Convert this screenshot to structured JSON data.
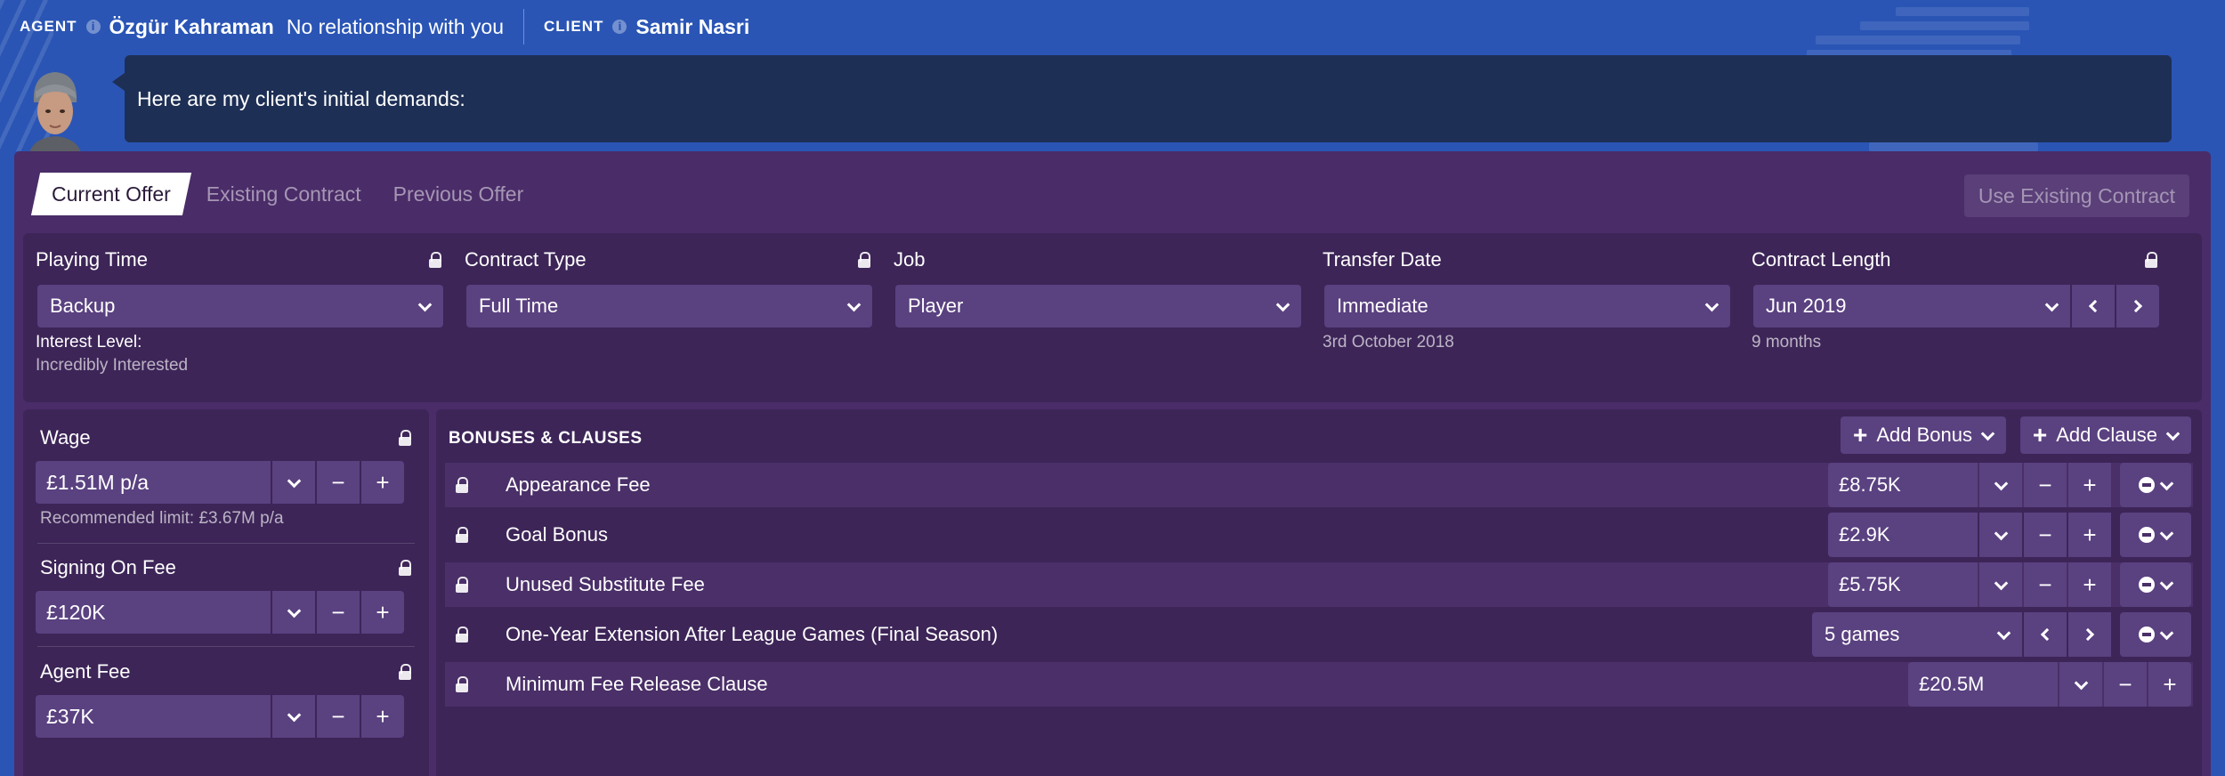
{
  "topbar": {
    "agent_label": "AGENT",
    "agent_name": "Özgür Kahraman",
    "agent_relationship": "No relationship with you",
    "client_label": "CLIENT",
    "client_name": "Samir Nasri"
  },
  "speech": {
    "text": "Here are my client's initial demands:"
  },
  "tabs": [
    {
      "label": "Current Offer",
      "active": true
    },
    {
      "label": "Existing Contract",
      "active": false
    },
    {
      "label": "Previous Offer",
      "active": false
    }
  ],
  "use_existing_button": "Use Existing Contract",
  "fields": {
    "playing_time": {
      "label": "Playing Time",
      "value": "Backup",
      "interest_label": "Interest Level:",
      "interest_value": "Incredibly Interested"
    },
    "contract_type": {
      "label": "Contract Type",
      "value": "Full Time"
    },
    "job": {
      "label": "Job",
      "value": "Player"
    },
    "transfer_date": {
      "label": "Transfer Date",
      "value": "Immediate",
      "sub": "3rd October 2018"
    },
    "contract_length": {
      "label": "Contract Length",
      "value": "Jun 2019",
      "sub": "9 months"
    }
  },
  "left": {
    "wage": {
      "label": "Wage",
      "value": "£1.51M p/a",
      "note": "Recommended limit: £3.67M p/a"
    },
    "signing_fee": {
      "label": "Signing On Fee",
      "value": "£120K"
    },
    "agent_fee": {
      "label": "Agent Fee",
      "value": "£37K"
    }
  },
  "bonuses": {
    "title": "BONUSES & CLAUSES",
    "add_bonus": "Add Bonus",
    "add_clause": "Add Clause",
    "rows": [
      {
        "name": "Appearance Fee",
        "value": "£8.75K"
      },
      {
        "name": "Goal Bonus",
        "value": "£2.9K"
      },
      {
        "name": "Unused Substitute Fee",
        "value": "£5.75K"
      },
      {
        "name": "One-Year Extension After League Games (Final Season)",
        "value": "5 games"
      },
      {
        "name": "Minimum Fee Release Clause",
        "value": "£20.5M"
      }
    ]
  },
  "symbols": {
    "minus": "−",
    "plus": "+"
  },
  "colors": {
    "background": "#2a55b5",
    "panel": "#4a2c68",
    "control": "#5a4180",
    "speech": "#1e2f55"
  }
}
